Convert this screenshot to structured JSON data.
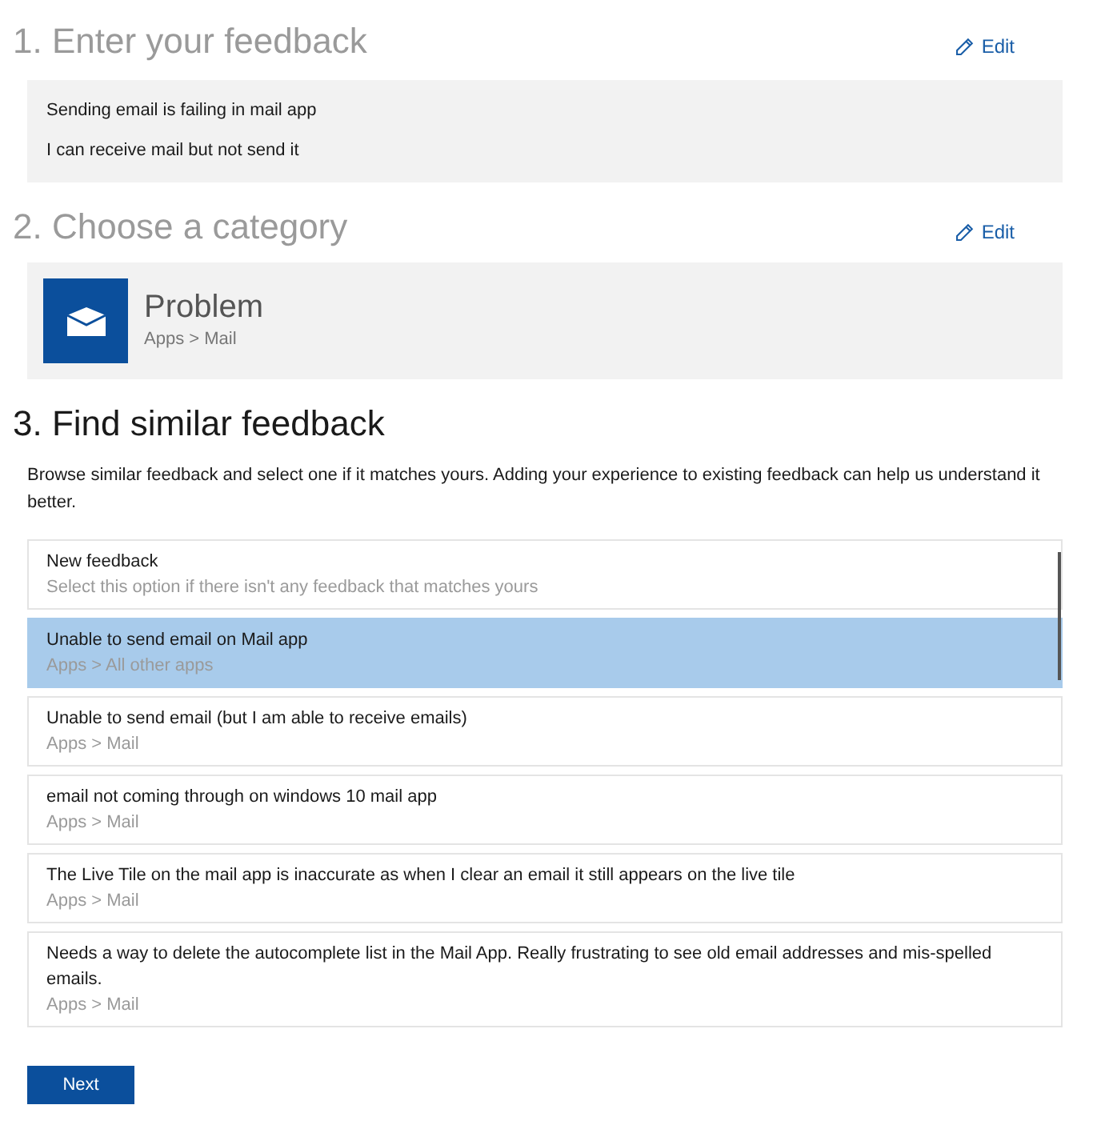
{
  "sections": [
    {
      "heading": "1. Enter your feedback",
      "active": false,
      "edit_link": "Edit",
      "feedback": [
        "Sending email is failing in mail app",
        "I can receive mail but not send it"
      ]
    },
    {
      "heading": "2. Choose a category",
      "active": false,
      "edit_link": "Edit",
      "category": {
        "title": "Problem",
        "path": "Apps > Mail"
      }
    },
    {
      "heading": "3. Find similar feedback",
      "active": true,
      "description": "Browse similar feedback and select one if it matches yours. Adding your experience to existing feedback can help us understand it better.",
      "results": [
        {
          "title": "New feedback",
          "subtitle": "Select this option if there isn't any feedback that matches yours",
          "selected": false
        },
        {
          "title": "Unable to send email on Mail app",
          "subtitle": "Apps > All other apps",
          "selected": true
        },
        {
          "title": "Unable to send email (but I am able to receive emails)",
          "subtitle": "Apps > Mail",
          "selected": false
        },
        {
          "title": "email not coming through on windows 10 mail app",
          "subtitle": "Apps > Mail",
          "selected": false
        },
        {
          "title": "The Live Tile on the mail app is inaccurate as when I clear an email it still appears on the live tile",
          "subtitle": "Apps > Mail",
          "selected": false
        },
        {
          "title": "Needs a way to delete the autocomplete list in the Mail App.  Really frustrating to see old email addresses and mis-spelled emails.",
          "subtitle": "Apps > Mail",
          "selected": false
        }
      ]
    }
  ],
  "next_button": "Next"
}
